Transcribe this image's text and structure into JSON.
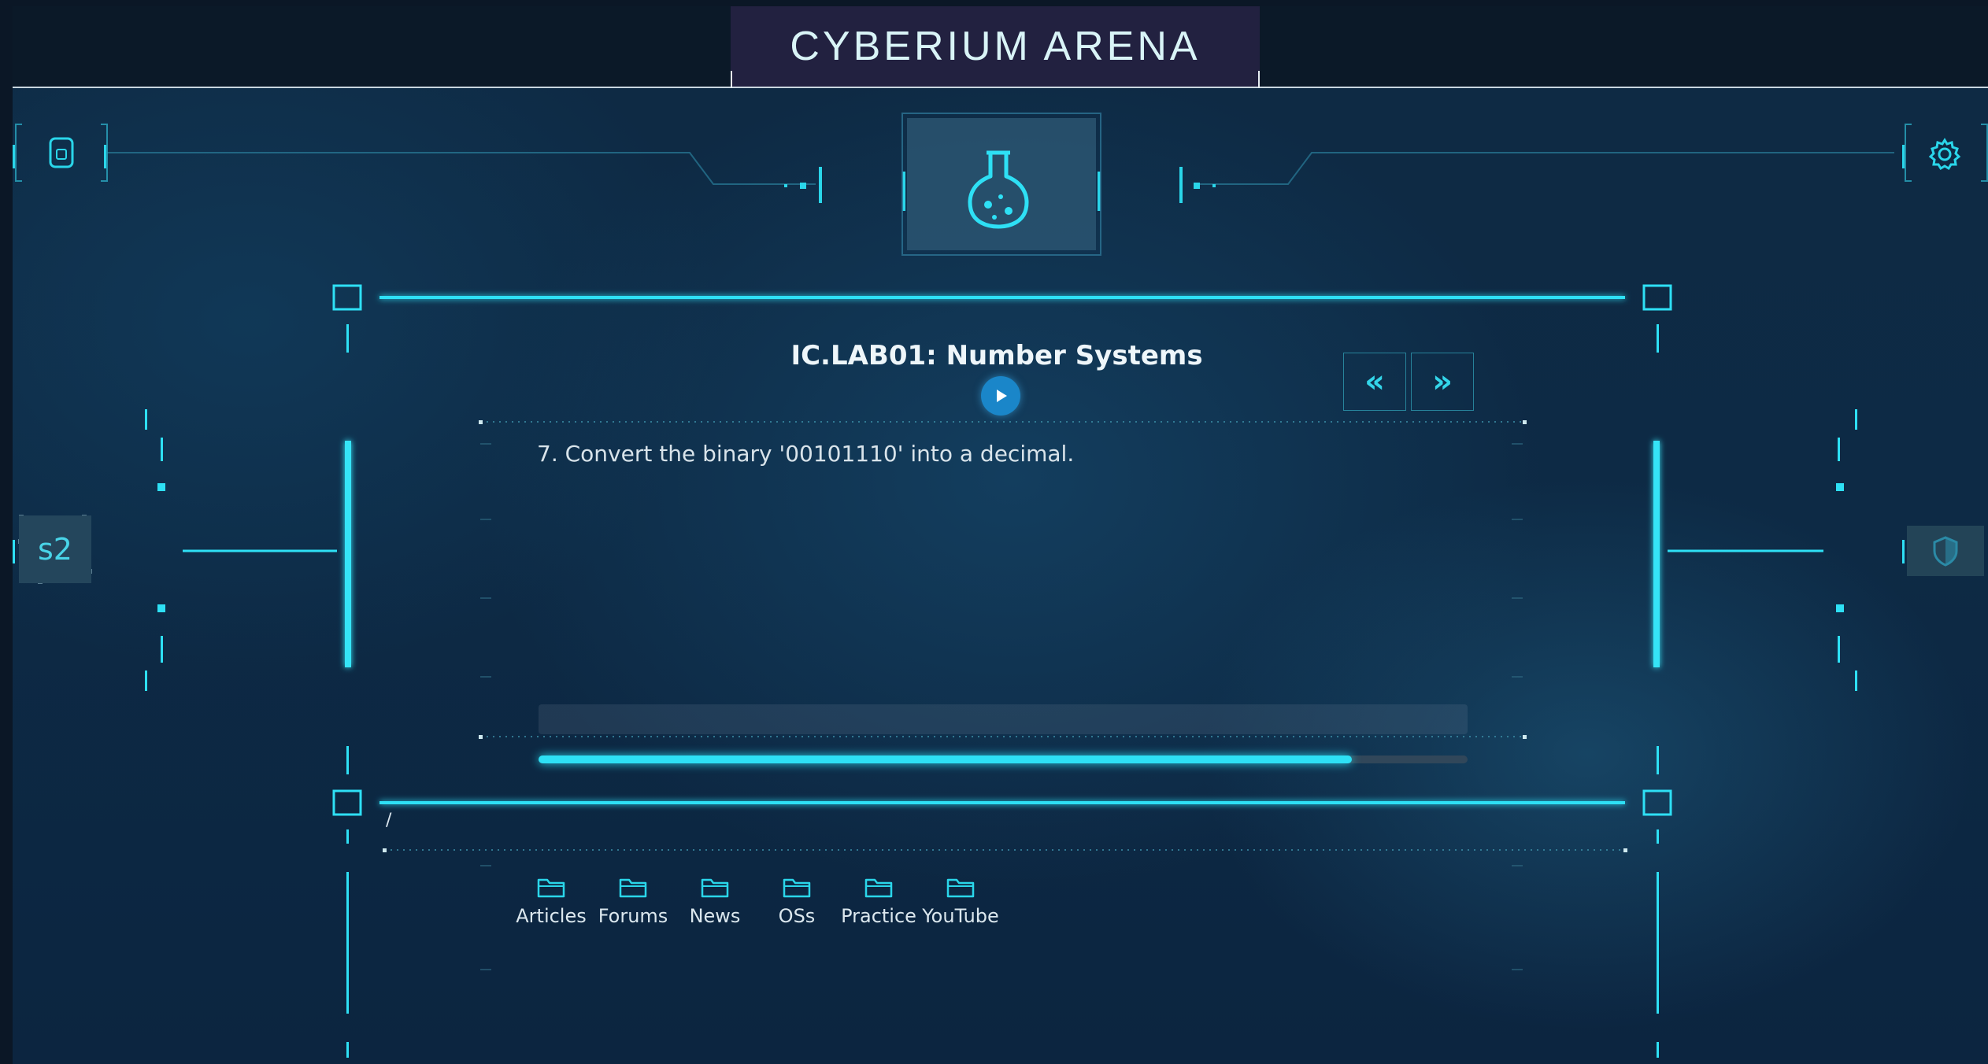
{
  "app": {
    "title": "CYBERIUM ARENA"
  },
  "lab": {
    "title": "IC.LAB01: Number Systems",
    "question": "7. Convert the binary '00101110' into a decimal.",
    "answer_value": "",
    "progress_fraction": 0.875
  },
  "navigation": {
    "prev_label": "«",
    "next_label": "»"
  },
  "side": {
    "section_label": "s2"
  },
  "files": {
    "path": "/",
    "folders": [
      {
        "label": "Articles"
      },
      {
        "label": "Forums"
      },
      {
        "label": "News"
      },
      {
        "label": "OSs"
      },
      {
        "label": "Practice"
      },
      {
        "label": "YouTube"
      }
    ]
  },
  "icons": {
    "top_left": "document-icon",
    "top_right": "gear-icon",
    "center": "flask-icon",
    "play": "play-icon",
    "right_side": "shield-icon",
    "folder": "folder-icon"
  },
  "colors": {
    "accent": "#2ee0f5",
    "title_bg": "#222140",
    "play": "#1a86c9"
  }
}
